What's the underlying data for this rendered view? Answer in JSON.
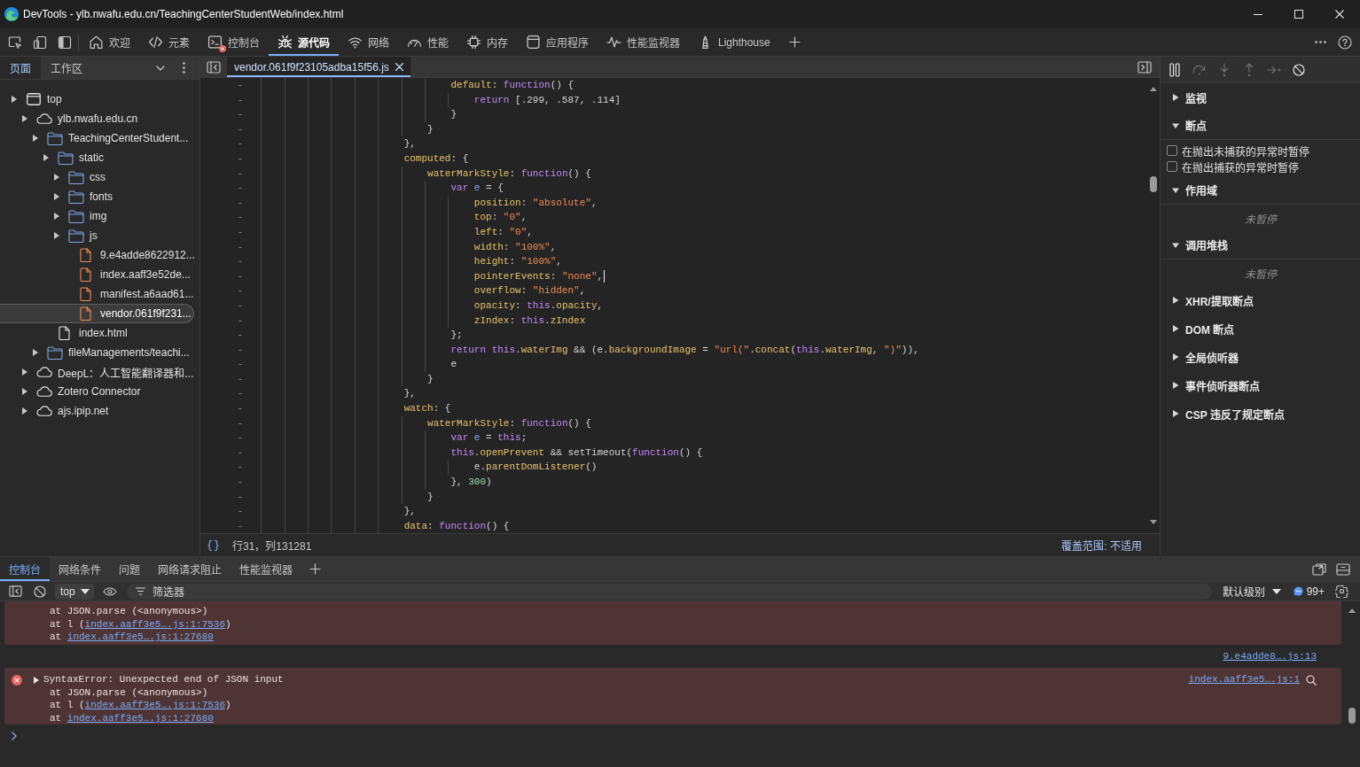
{
  "window": {
    "title": "DevTools - ylb.nwafu.edu.cn/TeachingCenterStudentWeb/index.html"
  },
  "main_tabs": [
    {
      "label": "欢迎",
      "selected": false,
      "error_badge": false
    },
    {
      "label": "元素",
      "selected": false,
      "error_badge": false
    },
    {
      "label": "控制台",
      "selected": false,
      "error_badge": true
    },
    {
      "label": "源代码",
      "selected": true,
      "error_badge": false
    },
    {
      "label": "网络",
      "selected": false,
      "error_badge": false
    },
    {
      "label": "性能",
      "selected": false,
      "error_badge": false
    },
    {
      "label": "内存",
      "selected": false,
      "error_badge": false
    },
    {
      "label": "应用程序",
      "selected": false,
      "error_badge": false
    },
    {
      "label": "性能监视器",
      "selected": false,
      "error_badge": false
    },
    {
      "label": "Lighthouse",
      "selected": false,
      "error_badge": false
    }
  ],
  "navigator": {
    "tabs": [
      {
        "label": "页面",
        "selected": true
      },
      {
        "label": "工作区",
        "selected": false
      }
    ],
    "tree": [
      {
        "label": "top",
        "kind": "frame",
        "selected": false,
        "children": [
          {
            "label": "ylb.nwafu.edu.cn",
            "kind": "domain",
            "selected": false,
            "children": [
              {
                "label": "TeachingCenterStudent...",
                "kind": "folder",
                "selected": false,
                "children": [
                  {
                    "label": "static",
                    "kind": "folder",
                    "selected": false,
                    "children": [
                      {
                        "label": "css",
                        "kind": "folder",
                        "selected": false
                      },
                      {
                        "label": "fonts",
                        "kind": "folder",
                        "selected": false
                      },
                      {
                        "label": "img",
                        "kind": "folder",
                        "selected": false
                      },
                      {
                        "label": "js",
                        "kind": "folder",
                        "selected": false,
                        "children": [
                          {
                            "label": "9.e4adde8622912...",
                            "kind": "script",
                            "selected": false
                          },
                          {
                            "label": "index.aaff3e52de...",
                            "kind": "script",
                            "selected": false
                          },
                          {
                            "label": "manifest.a6aad61...",
                            "kind": "script",
                            "selected": false
                          },
                          {
                            "label": "vendor.061f9f231...",
                            "kind": "script",
                            "selected": true
                          }
                        ]
                      }
                    ]
                  },
                  {
                    "label": "index.html",
                    "kind": "document",
                    "selected": false
                  }
                ]
              },
              {
                "label": "fileManagements/teachi...",
                "kind": "folder",
                "selected": false
              }
            ]
          },
          {
            "label": "DeepL：人工智能翻译器和...",
            "kind": "domain",
            "selected": false
          },
          {
            "label": "Zotero Connector",
            "kind": "domain",
            "selected": false
          },
          {
            "label": "ajs.ipip.net",
            "kind": "domain",
            "selected": false
          }
        ]
      }
    ]
  },
  "editor": {
    "tabs": [
      {
        "label": "vendor.061f9f23105adba15f56.js",
        "selected": true
      }
    ],
    "lines": [
      {
        "line_number": "-",
        "cursor": false,
        "tokens": [
          {
            "text": "                                  default",
            "kind": "property"
          },
          {
            "text": ": ",
            "kind": "plain"
          },
          {
            "text": "function",
            "kind": "keyword"
          },
          {
            "text": "() {",
            "kind": "plain"
          }
        ]
      },
      {
        "line_number": "-",
        "cursor": false,
        "tokens": [
          {
            "text": "                                      return",
            "kind": "keyword"
          },
          {
            "text": " [.299, .587, .114]",
            "kind": "plain"
          }
        ]
      },
      {
        "line_number": "-",
        "cursor": false,
        "tokens": [
          {
            "text": "                                  }",
            "kind": "plain"
          }
        ]
      },
      {
        "line_number": "-",
        "cursor": false,
        "tokens": [
          {
            "text": "                              }",
            "kind": "plain"
          }
        ]
      },
      {
        "line_number": "-",
        "cursor": false,
        "tokens": [
          {
            "text": "                          },",
            "kind": "plain"
          }
        ]
      },
      {
        "line_number": "-",
        "cursor": false,
        "tokens": [
          {
            "text": "                          computed",
            "kind": "property"
          },
          {
            "text": ": {",
            "kind": "plain"
          }
        ]
      },
      {
        "line_number": "-",
        "cursor": false,
        "tokens": [
          {
            "text": "                              waterMarkStyle",
            "kind": "property"
          },
          {
            "text": ": ",
            "kind": "plain"
          },
          {
            "text": "function",
            "kind": "keyword"
          },
          {
            "text": "() {",
            "kind": "plain"
          }
        ]
      },
      {
        "line_number": "-",
        "cursor": false,
        "tokens": [
          {
            "text": "                                  var ",
            "kind": "keyword"
          },
          {
            "text": "e",
            "kind": "variable"
          },
          {
            "text": " = {",
            "kind": "plain"
          }
        ]
      },
      {
        "line_number": "-",
        "cursor": false,
        "tokens": [
          {
            "text": "                                      position",
            "kind": "property"
          },
          {
            "text": ": ",
            "kind": "plain"
          },
          {
            "text": "\"absolute\"",
            "kind": "string"
          },
          {
            "text": ",",
            "kind": "plain"
          }
        ]
      },
      {
        "line_number": "-",
        "cursor": false,
        "tokens": [
          {
            "text": "                                      top",
            "kind": "property"
          },
          {
            "text": ": ",
            "kind": "plain"
          },
          {
            "text": "\"0\"",
            "kind": "string"
          },
          {
            "text": ",",
            "kind": "plain"
          }
        ]
      },
      {
        "line_number": "-",
        "cursor": false,
        "tokens": [
          {
            "text": "                                      left",
            "kind": "property"
          },
          {
            "text": ": ",
            "kind": "plain"
          },
          {
            "text": "\"0\"",
            "kind": "string"
          },
          {
            "text": ",",
            "kind": "plain"
          }
        ]
      },
      {
        "line_number": "-",
        "cursor": false,
        "tokens": [
          {
            "text": "                                      width",
            "kind": "property"
          },
          {
            "text": ": ",
            "kind": "plain"
          },
          {
            "text": "\"100%\"",
            "kind": "string"
          },
          {
            "text": ",",
            "kind": "plain"
          }
        ]
      },
      {
        "line_number": "-",
        "cursor": false,
        "tokens": [
          {
            "text": "                                      height",
            "kind": "property"
          },
          {
            "text": ": ",
            "kind": "plain"
          },
          {
            "text": "\"100%\"",
            "kind": "string"
          },
          {
            "text": ",",
            "kind": "plain"
          }
        ]
      },
      {
        "line_number": "-",
        "cursor": true,
        "tokens": [
          {
            "text": "                                      pointerEvents",
            "kind": "property"
          },
          {
            "text": ": ",
            "kind": "plain"
          },
          {
            "text": "\"none\"",
            "kind": "string"
          },
          {
            "text": ",",
            "kind": "plain"
          }
        ]
      },
      {
        "line_number": "-",
        "cursor": false,
        "tokens": [
          {
            "text": "                                      overflow",
            "kind": "property"
          },
          {
            "text": ": ",
            "kind": "plain"
          },
          {
            "text": "\"hidden\"",
            "kind": "string"
          },
          {
            "text": ",",
            "kind": "plain"
          }
        ]
      },
      {
        "line_number": "-",
        "cursor": false,
        "tokens": [
          {
            "text": "                                      opacity",
            "kind": "property"
          },
          {
            "text": ": ",
            "kind": "plain"
          },
          {
            "text": "this",
            "kind": "keyword"
          },
          {
            "text": ".",
            "kind": "plain"
          },
          {
            "text": "opacity",
            "kind": "property"
          },
          {
            "text": ",",
            "kind": "plain"
          }
        ]
      },
      {
        "line_number": "-",
        "cursor": false,
        "tokens": [
          {
            "text": "                                      zIndex",
            "kind": "property"
          },
          {
            "text": ": ",
            "kind": "plain"
          },
          {
            "text": "this",
            "kind": "keyword"
          },
          {
            "text": ".",
            "kind": "plain"
          },
          {
            "text": "zIndex",
            "kind": "property"
          }
        ]
      },
      {
        "line_number": "-",
        "cursor": false,
        "tokens": [
          {
            "text": "                                  };",
            "kind": "plain"
          }
        ]
      },
      {
        "line_number": "-",
        "cursor": false,
        "tokens": [
          {
            "text": "                                  return ",
            "kind": "keyword"
          },
          {
            "text": "this",
            "kind": "keyword"
          },
          {
            "text": ".",
            "kind": "plain"
          },
          {
            "text": "waterImg",
            "kind": "property"
          },
          {
            "text": " && (e.",
            "kind": "plain"
          },
          {
            "text": "backgroundImage",
            "kind": "property"
          },
          {
            "text": " = ",
            "kind": "plain"
          },
          {
            "text": "\"url(\"",
            "kind": "string"
          },
          {
            "text": ".",
            "kind": "plain"
          },
          {
            "text": "concat",
            "kind": "property"
          },
          {
            "text": "(",
            "kind": "plain"
          },
          {
            "text": "this",
            "kind": "keyword"
          },
          {
            "text": ".",
            "kind": "plain"
          },
          {
            "text": "waterImg",
            "kind": "property"
          },
          {
            "text": ", ",
            "kind": "plain"
          },
          {
            "text": "\")\"",
            "kind": "string"
          },
          {
            "text": ")),",
            "kind": "plain"
          }
        ]
      },
      {
        "line_number": "-",
        "cursor": false,
        "tokens": [
          {
            "text": "                                  e",
            "kind": "plain"
          }
        ]
      },
      {
        "line_number": "-",
        "cursor": false,
        "tokens": [
          {
            "text": "                              }",
            "kind": "plain"
          }
        ]
      },
      {
        "line_number": "-",
        "cursor": false,
        "tokens": [
          {
            "text": "                          },",
            "kind": "plain"
          }
        ]
      },
      {
        "line_number": "-",
        "cursor": false,
        "tokens": [
          {
            "text": "                          watch",
            "kind": "property"
          },
          {
            "text": ": {",
            "kind": "plain"
          }
        ]
      },
      {
        "line_number": "-",
        "cursor": false,
        "tokens": [
          {
            "text": "                              waterMarkStyle",
            "kind": "property"
          },
          {
            "text": ": ",
            "kind": "plain"
          },
          {
            "text": "function",
            "kind": "keyword"
          },
          {
            "text": "() {",
            "kind": "plain"
          }
        ]
      },
      {
        "line_number": "-",
        "cursor": false,
        "tokens": [
          {
            "text": "                                  var ",
            "kind": "keyword"
          },
          {
            "text": "e",
            "kind": "variable"
          },
          {
            "text": " = ",
            "kind": "plain"
          },
          {
            "text": "this",
            "kind": "keyword"
          },
          {
            "text": ";",
            "kind": "plain"
          }
        ]
      },
      {
        "line_number": "-",
        "cursor": false,
        "tokens": [
          {
            "text": "                                  this",
            "kind": "keyword"
          },
          {
            "text": ".",
            "kind": "plain"
          },
          {
            "text": "openPrevent",
            "kind": "property"
          },
          {
            "text": " && setTimeout(",
            "kind": "plain"
          },
          {
            "text": "function",
            "kind": "keyword"
          },
          {
            "text": "() {",
            "kind": "plain"
          }
        ]
      },
      {
        "line_number": "-",
        "cursor": false,
        "tokens": [
          {
            "text": "                                      e.",
            "kind": "plain"
          },
          {
            "text": "parentDomListener",
            "kind": "property"
          },
          {
            "text": "()",
            "kind": "plain"
          }
        ]
      },
      {
        "line_number": "-",
        "cursor": false,
        "tokens": [
          {
            "text": "                                  }, ",
            "kind": "plain"
          },
          {
            "text": "300",
            "kind": "number"
          },
          {
            "text": ")",
            "kind": "plain"
          }
        ]
      },
      {
        "line_number": "-",
        "cursor": false,
        "tokens": [
          {
            "text": "                              }",
            "kind": "plain"
          }
        ]
      },
      {
        "line_number": "-",
        "cursor": false,
        "tokens": [
          {
            "text": "                          },",
            "kind": "plain"
          }
        ]
      },
      {
        "line_number": "-",
        "cursor": false,
        "tokens": [
          {
            "text": "                          data",
            "kind": "property"
          },
          {
            "text": ": ",
            "kind": "plain"
          },
          {
            "text": "function",
            "kind": "keyword"
          },
          {
            "text": "() {",
            "kind": "plain"
          }
        ]
      }
    ],
    "status": {
      "position": "行31，列131281",
      "coverage": "覆盖范围: 不适用"
    }
  },
  "debugger": {
    "sections": [
      {
        "title": "监视",
        "expanded": false
      },
      {
        "title": "断点",
        "expanded": true,
        "options": [
          {
            "label": "在抛出未捕获的异常时暂停",
            "checked": false
          },
          {
            "label": "在抛出捕获的异常时暂停",
            "checked": false
          }
        ]
      },
      {
        "title": "作用域",
        "expanded": true,
        "note": "未暂停"
      },
      {
        "title": "调用堆栈",
        "expanded": true,
        "note": "未暂停"
      },
      {
        "title": "XHR/提取断点",
        "expanded": false
      },
      {
        "title": "DOM 断点",
        "expanded": false
      },
      {
        "title": "全局侦听器",
        "expanded": false
      },
      {
        "title": "事件侦听器断点",
        "expanded": false
      },
      {
        "title": "CSP 违反了规定断点",
        "expanded": false
      }
    ]
  },
  "drawer": {
    "tabs": [
      {
        "label": "控制台",
        "selected": true
      },
      {
        "label": "网络条件",
        "selected": false
      },
      {
        "label": "问题",
        "selected": false
      },
      {
        "label": "网络请求阻止",
        "selected": false
      },
      {
        "label": "性能监视器",
        "selected": false
      }
    ],
    "toolbar": {
      "context": "top",
      "filter": {
        "placeholder": "筛选器"
      },
      "level": "默认级别",
      "issues_count": "99+"
    },
    "messages": [
      {
        "kind": "error",
        "stack": [
          {
            "text": "at JSON.parse (<anonymous>)"
          },
          {
            "text": "at l (",
            "link": "index.aaff3e5….js:1:7536",
            "after": ")"
          },
          {
            "text": "at ",
            "link": "index.aaff3e5….js:1:27680"
          }
        ]
      },
      {
        "kind": "log",
        "source": "9.e4adde8….js:13"
      },
      {
        "kind": "error",
        "text": "SyntaxError: Unexpected end of JSON input",
        "source": "index.aaff3e5….js:1",
        "stack": [
          {
            "text": "at JSON.parse (<anonymous>)"
          },
          {
            "text": "at l (",
            "link": "index.aaff3e5….js:1:7536",
            "after": ")"
          },
          {
            "text": "at ",
            "link": "index.aaff3e5….js:1:27680"
          }
        ]
      }
    ]
  }
}
